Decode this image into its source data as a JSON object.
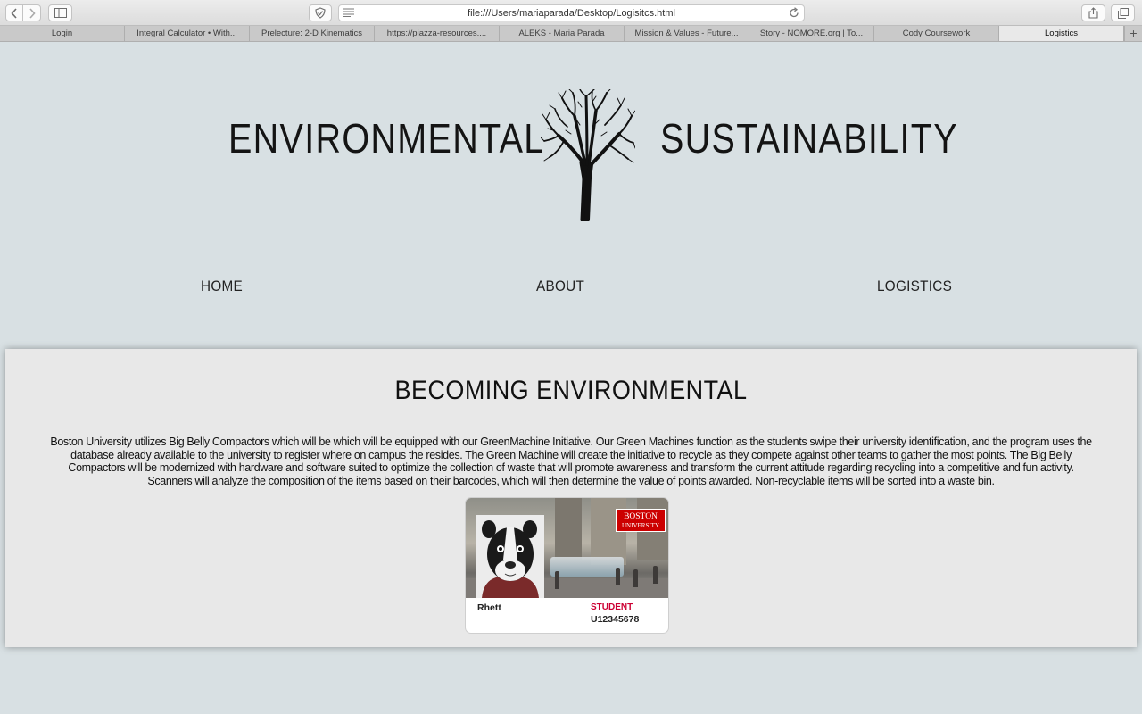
{
  "browser": {
    "url": "file:///Users/mariaparada/Desktop/Logisitcs.html",
    "tabs": [
      {
        "label": "Login",
        "active": false
      },
      {
        "label": "Integral Calculator • With...",
        "active": false
      },
      {
        "label": "Prelecture: 2-D Kinematics",
        "active": false
      },
      {
        "label": "https://piazza-resources....",
        "active": false
      },
      {
        "label": "ALEKS - Maria Parada",
        "active": false
      },
      {
        "label": "Mission & Values - Future...",
        "active": false
      },
      {
        "label": "Story - NOMORE.org | To...",
        "active": false
      },
      {
        "label": "Cody Coursework",
        "active": false
      },
      {
        "label": "Logistics",
        "active": true
      }
    ],
    "new_tab_label": "+"
  },
  "header": {
    "title_left": "ENVIRONMENTAL",
    "title_right": "SUSTAINABILITY",
    "logo_icon": "tree-icon"
  },
  "nav": {
    "home": "HOME",
    "about": "ABOUT",
    "logistics": "LOGISTICS"
  },
  "section": {
    "title": "BECOMING ENVIRONMENTAL",
    "body": "Boston University utilizes Big Belly Compactors which will be which will be equipped with our GreenMachine Initiative. Our Green Machines function as the students swipe their university identification, and the program uses the database already available to the university to register where on campus the resides. The Green Machine will create the initiative to recycle as they compete against other teams to gather the most points. The Big Belly Compactors will be modernized with hardware and software suited to optimize the collection of waste that will promote awareness and transform the current attitude regarding recycling into a competitive and fun activity. Scanners will analyze the composition of the items based on their barcodes, which will then determine the value of points awarded. Non-recyclable items will be sorted into a waste bin."
  },
  "id_card": {
    "logo_line1": "BOSTON",
    "logo_line2": "UNIVERSITY",
    "name": "Rhett",
    "role": "STUDENT",
    "id_number": "U12345678",
    "accent_color": "#cc0033"
  }
}
